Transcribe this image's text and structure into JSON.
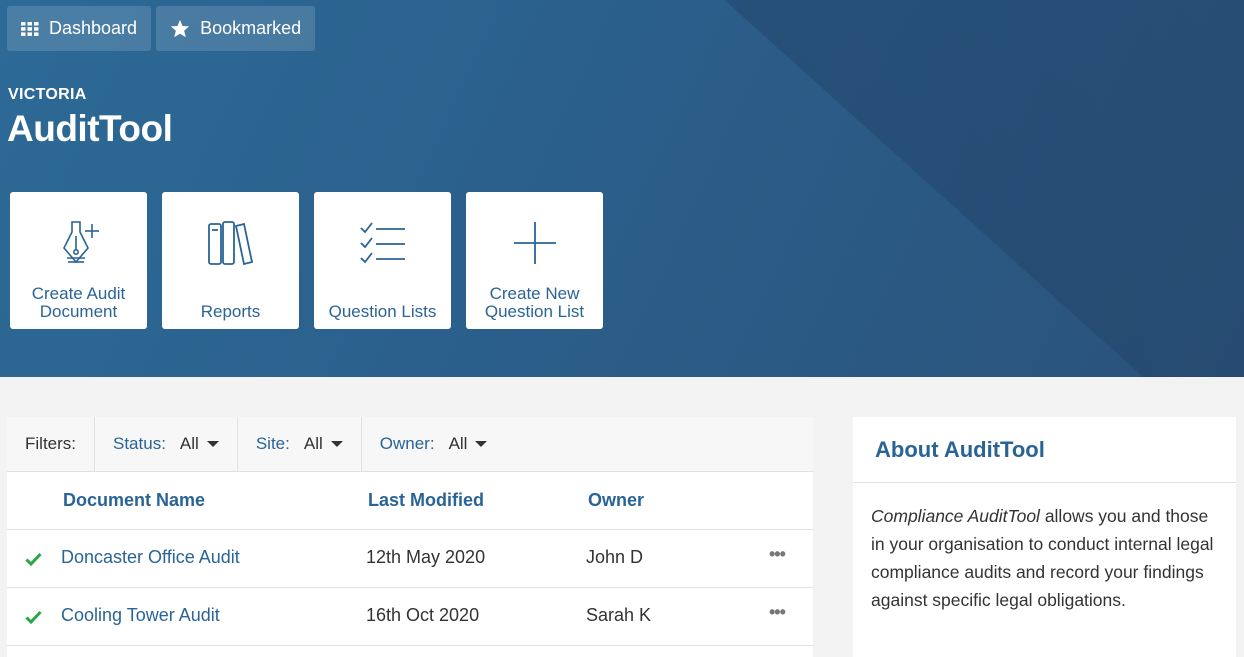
{
  "nav": {
    "dashboard_label": "Dashboard",
    "bookmarked_label": "Bookmarked"
  },
  "header": {
    "org": "VICTORIA",
    "app_title": "AuditTool"
  },
  "tiles": [
    {
      "label": "Create Audit\nDocument",
      "icon": "pen-plus-icon"
    },
    {
      "label": "Reports",
      "icon": "books-icon"
    },
    {
      "label": "Question Lists",
      "icon": "checklist-icon"
    },
    {
      "label": "Create New\nQuestion List",
      "icon": "plus-icon"
    }
  ],
  "filters": {
    "label": "Filters:",
    "status": {
      "label": "Status:",
      "value": "All"
    },
    "site": {
      "label": "Site:",
      "value": "All"
    },
    "owner": {
      "label": "Owner:",
      "value": "All"
    }
  },
  "table": {
    "headers": {
      "name": "Document Name",
      "modified": "Last Modified",
      "owner": "Owner"
    },
    "rows": [
      {
        "name": "Doncaster Office Audit",
        "modified": "12th May 2020",
        "owner": "John D",
        "more": "•••"
      },
      {
        "name": "Cooling Tower Audit",
        "modified": "16th Oct 2020",
        "owner": "Sarah K",
        "more": "•••"
      }
    ]
  },
  "about": {
    "title": "About AuditTool",
    "intro_em": "Compliance AuditTool",
    "body": " allows you and those in your organisation to conduct internal legal compliance audits and record your findings against specific legal obligations."
  },
  "colors": {
    "accent": "#2a6496",
    "check": "#28a745",
    "hero": "#2b5f8b"
  }
}
